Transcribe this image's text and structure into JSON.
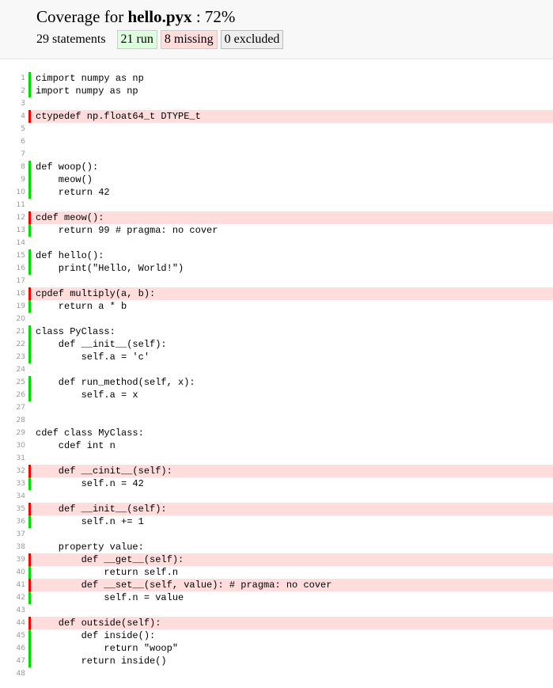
{
  "header": {
    "title_prefix": "Coverage for ",
    "file_name": "hello.pyx",
    "title_suffix": " : 72%",
    "statements": "29 statements",
    "run": "21 run",
    "missing": "8 missing",
    "excluded": "0 excluded"
  },
  "lines": [
    {
      "n": "1",
      "code": "cimport numpy as np",
      "s": "run"
    },
    {
      "n": "2",
      "code": "import numpy as np",
      "s": "run"
    },
    {
      "n": "3",
      "code": "",
      "s": "none"
    },
    {
      "n": "4",
      "code": "ctypedef np.float64_t DTYPE_t",
      "s": "mis"
    },
    {
      "n": "5",
      "code": "",
      "s": "none"
    },
    {
      "n": "6",
      "code": "",
      "s": "none"
    },
    {
      "n": "7",
      "code": "",
      "s": "none"
    },
    {
      "n": "8",
      "code": "def woop():",
      "s": "run"
    },
    {
      "n": "9",
      "code": "    meow()",
      "s": "run"
    },
    {
      "n": "10",
      "code": "    return 42",
      "s": "run"
    },
    {
      "n": "11",
      "code": "",
      "s": "none"
    },
    {
      "n": "12",
      "code": "cdef meow():",
      "s": "mis"
    },
    {
      "n": "13",
      "code": "    return 99 # pragma: no cover",
      "s": "run"
    },
    {
      "n": "14",
      "code": "",
      "s": "none"
    },
    {
      "n": "15",
      "code": "def hello():",
      "s": "run"
    },
    {
      "n": "16",
      "code": "    print(\"Hello, World!\")",
      "s": "run"
    },
    {
      "n": "17",
      "code": "",
      "s": "none"
    },
    {
      "n": "18",
      "code": "cpdef multiply(a, b):",
      "s": "mis"
    },
    {
      "n": "19",
      "code": "    return a * b",
      "s": "run"
    },
    {
      "n": "20",
      "code": "",
      "s": "none"
    },
    {
      "n": "21",
      "code": "class PyClass:",
      "s": "run"
    },
    {
      "n": "22",
      "code": "    def __init__(self):",
      "s": "run"
    },
    {
      "n": "23",
      "code": "        self.a = 'c'",
      "s": "run"
    },
    {
      "n": "24",
      "code": "",
      "s": "none"
    },
    {
      "n": "25",
      "code": "    def run_method(self, x):",
      "s": "run"
    },
    {
      "n": "26",
      "code": "        self.a = x",
      "s": "run"
    },
    {
      "n": "27",
      "code": "",
      "s": "none"
    },
    {
      "n": "28",
      "code": "",
      "s": "none"
    },
    {
      "n": "29",
      "code": "cdef class MyClass:",
      "s": "none"
    },
    {
      "n": "30",
      "code": "    cdef int n",
      "s": "none"
    },
    {
      "n": "31",
      "code": "",
      "s": "none"
    },
    {
      "n": "32",
      "code": "    def __cinit__(self):",
      "s": "mis"
    },
    {
      "n": "33",
      "code": "        self.n = 42",
      "s": "run"
    },
    {
      "n": "34",
      "code": "",
      "s": "none"
    },
    {
      "n": "35",
      "code": "    def __init__(self):",
      "s": "mis"
    },
    {
      "n": "36",
      "code": "        self.n += 1",
      "s": "run"
    },
    {
      "n": "37",
      "code": "",
      "s": "none"
    },
    {
      "n": "38",
      "code": "    property value:",
      "s": "none"
    },
    {
      "n": "39",
      "code": "        def __get__(self):",
      "s": "mis"
    },
    {
      "n": "40",
      "code": "            return self.n",
      "s": "run"
    },
    {
      "n": "41",
      "code": "        def __set__(self, value): # pragma: no cover",
      "s": "mis"
    },
    {
      "n": "42",
      "code": "            self.n = value",
      "s": "run"
    },
    {
      "n": "43",
      "code": "",
      "s": "none"
    },
    {
      "n": "44",
      "code": "    def outside(self):",
      "s": "mis"
    },
    {
      "n": "45",
      "code": "        def inside():",
      "s": "run"
    },
    {
      "n": "46",
      "code": "            return \"woop\"",
      "s": "run"
    },
    {
      "n": "47",
      "code": "        return inside()",
      "s": "run"
    },
    {
      "n": "48",
      "code": "",
      "s": "none"
    }
  ]
}
